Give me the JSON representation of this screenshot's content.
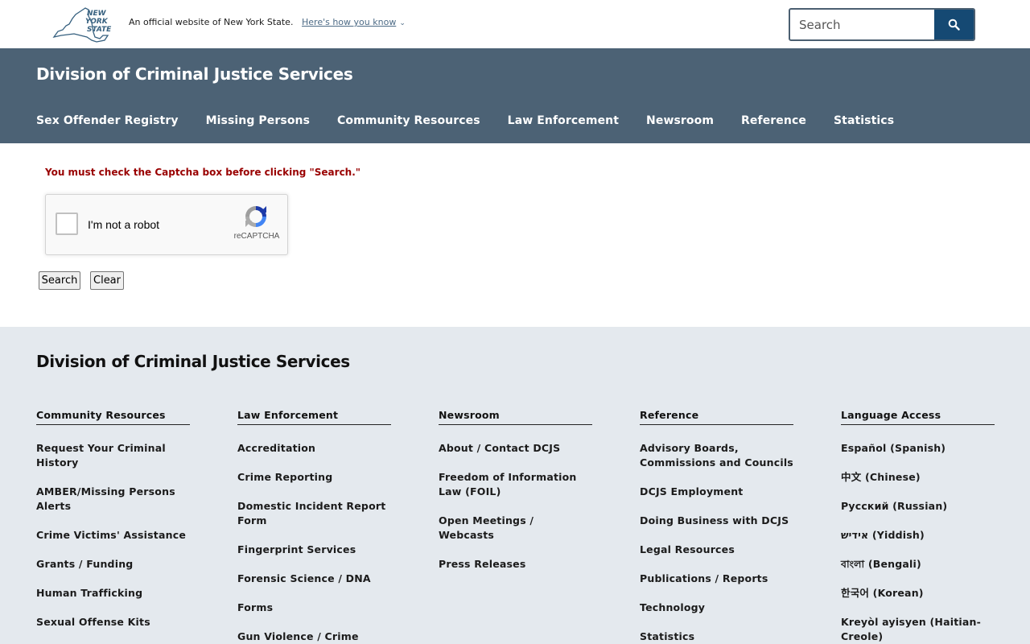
{
  "topbar": {
    "logo_text": "NEW YORK STATE",
    "official_text": "An official website of New York State.",
    "how_link": "Here's how you know",
    "search_placeholder": "Search"
  },
  "header": {
    "agency_title": "Division of Criminal Justice Services",
    "nav": [
      "Sex Offender Registry",
      "Missing Persons",
      "Community Resources",
      "Law Enforcement",
      "Newsroom",
      "Reference",
      "Statistics"
    ]
  },
  "main": {
    "error_message": "You must check the Captcha box before clicking \"Search.\"",
    "recaptcha": {
      "label": "I'm not a robot",
      "brand": "reCAPTCHA"
    },
    "buttons": {
      "search": "Search",
      "clear": "Clear"
    }
  },
  "footer": {
    "title": "Division of Criminal Justice Services",
    "columns": [
      {
        "heading": "Community Resources",
        "links": [
          "Request Your Criminal History",
          "AMBER/Missing Persons Alerts",
          "Crime Victims' Assistance",
          "Grants / Funding",
          "Human Trafficking",
          "Sexual Offense Kits"
        ]
      },
      {
        "heading": "Law Enforcement",
        "links": [
          "Accreditation",
          "Crime Reporting",
          "Domestic Incident Report Form",
          "Fingerprint Services",
          "Forensic Science / DNA",
          "Forms",
          "Gun Violence / Crime"
        ]
      },
      {
        "heading": "Newsroom",
        "links": [
          "About / Contact DCJS",
          "Freedom of Information Law (FOIL)",
          "Open Meetings / Webcasts",
          "Press Releases"
        ]
      },
      {
        "heading": "Reference",
        "links": [
          "Advisory Boards, Commissions and Councils",
          "DCJS Employment",
          "Doing Business with DCJS",
          "Legal Resources",
          "Publications / Reports",
          "Technology",
          "Statistics"
        ]
      },
      {
        "heading": "Language Access",
        "links": [
          "Español (Spanish)",
          "中文 (Chinese)",
          "Русский (Russian)",
          "אידיש (Yiddish)",
          "বাংলা (Bengali)",
          "한국어 (Korean)",
          "Kreyòl ayisyen (Haitian-Creole)"
        ]
      }
    ]
  },
  "colors": {
    "header_bg": "#4c6275",
    "search_button": "#154973",
    "error": "#990000",
    "footer_bg": "#e4e9ee",
    "link_blue": "#4d6b86"
  },
  "icons": {
    "search_button": "search-icon",
    "how_link": "chevron-down-icon",
    "logo": "nys-state-outline-logo",
    "recaptcha": "recaptcha-logo-icon"
  }
}
